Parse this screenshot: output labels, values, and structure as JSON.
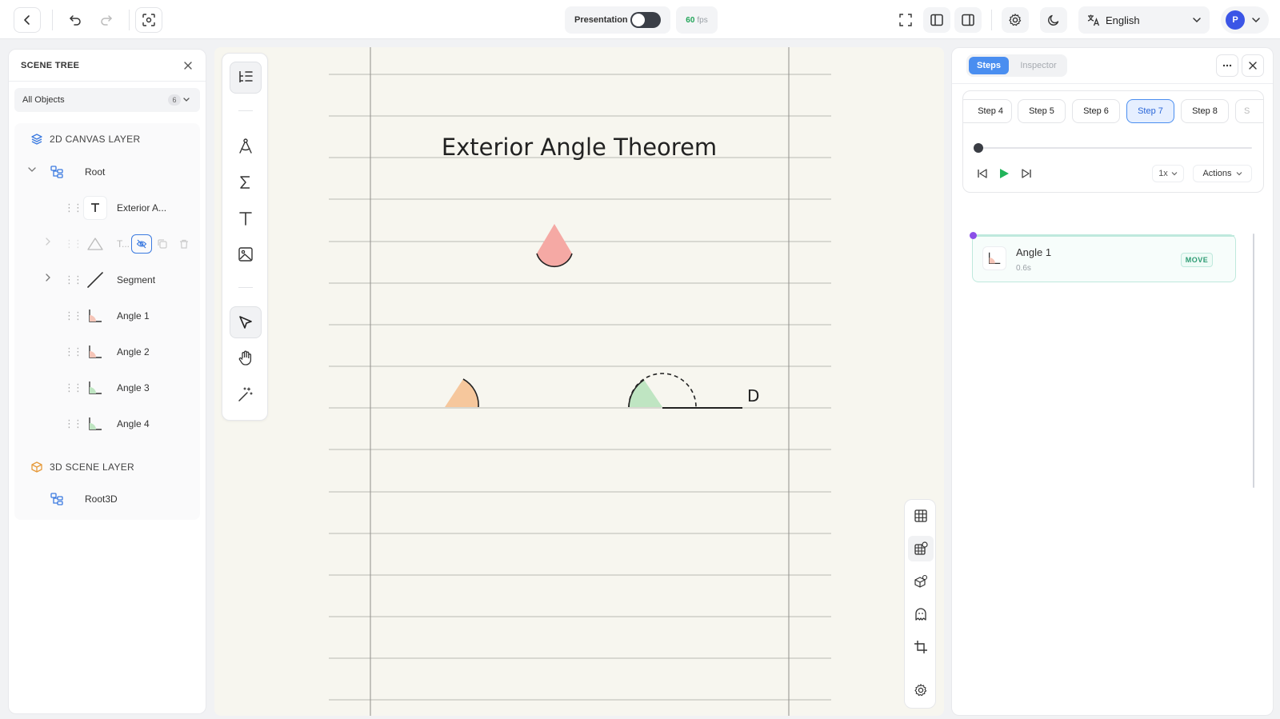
{
  "topbar": {
    "presentation_label": "Presentation",
    "fps_value": "60",
    "fps_unit": "fps",
    "language": "English",
    "avatar_initial": "P"
  },
  "scene_tree": {
    "title": "SCENE TREE",
    "filter_label": "All Objects",
    "filter_count": "6",
    "layer_2d_title": "2D CANVAS LAYER",
    "root_label": "Root",
    "items": [
      {
        "label": "Exterior A...",
        "icon": "text-icon"
      },
      {
        "label": "T...",
        "icon": "triangle-icon"
      },
      {
        "label": "Segment",
        "icon": "segment-icon"
      },
      {
        "label": "Angle 1",
        "icon": "angle-icon"
      },
      {
        "label": "Angle 2",
        "icon": "angle-icon"
      },
      {
        "label": "Angle 3",
        "icon": "angle-icon"
      },
      {
        "label": "Angle 4",
        "icon": "angle-icon"
      }
    ],
    "layer_3d_title": "3D SCENE LAYER",
    "root3d_label": "Root3D"
  },
  "canvas": {
    "title": "Exterior Angle Theorem",
    "point_label": "D",
    "colors": {
      "angle_red": "#f5a9a4",
      "angle_orange": "#f6c79c",
      "angle_green": "#bfe5c2",
      "paper": "#f7f6ef"
    }
  },
  "right_panel": {
    "tab_steps": "Steps",
    "tab_inspector": "Inspector",
    "steps": [
      "Step 4",
      "Step 5",
      "Step 6",
      "Step 7",
      "Step 8",
      "S"
    ],
    "active_step": "Step 7",
    "speed": "1x",
    "actions_label": "Actions",
    "timeline_item": {
      "title": "Angle 1",
      "duration": "0.6s",
      "badge": "MOVE"
    },
    "accent": "#4a8ef0"
  }
}
